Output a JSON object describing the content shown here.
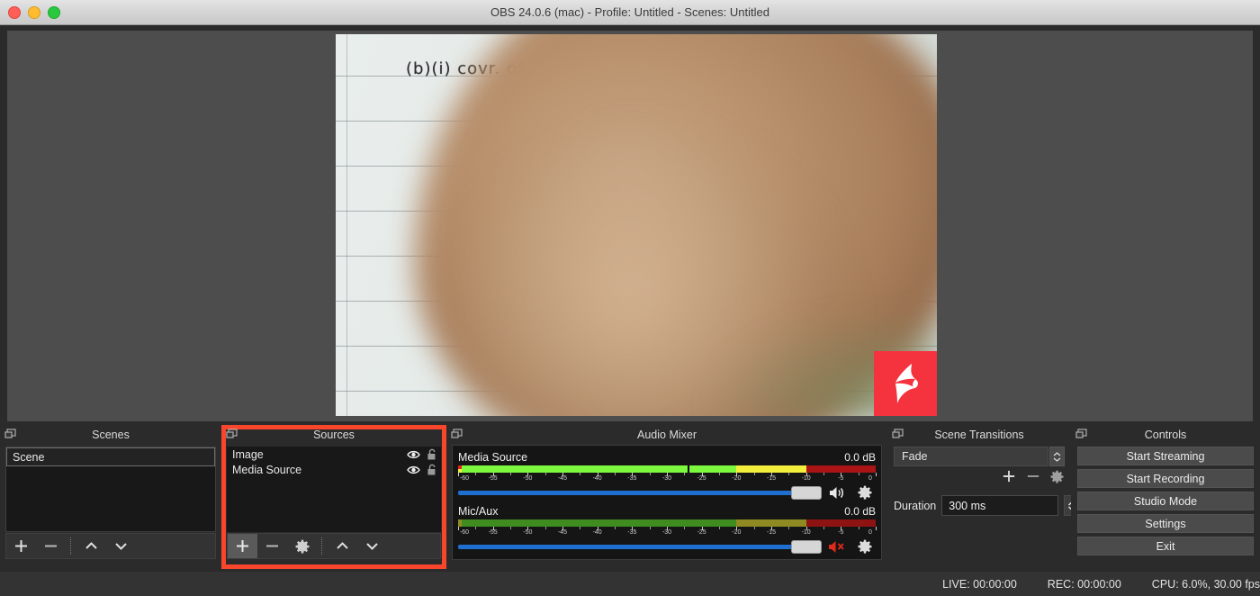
{
  "window": {
    "title": "OBS 24.0.6 (mac) - Profile: Untitled - Scenes: Untitled",
    "buttons": {
      "close": "close",
      "minimize": "minimize",
      "zoom": "zoom"
    }
  },
  "preview": {
    "handwriting": "(b)(i)   covr. of Q = (b,b",
    "watermark": "kinemaster-logo"
  },
  "scenes": {
    "title": "Scenes",
    "items": [
      {
        "label": "Scene",
        "selected": true
      }
    ],
    "toolbar": [
      {
        "name": "add-scene-button",
        "icon": "plus-icon"
      },
      {
        "name": "remove-scene-button",
        "icon": "minus-icon"
      },
      {
        "name": "move-scene-up-button",
        "icon": "chevron-up-icon"
      },
      {
        "name": "move-scene-down-button",
        "icon": "chevron-down-icon"
      }
    ]
  },
  "sources": {
    "title": "Sources",
    "highlighted": true,
    "highlight_color": "#f8452b",
    "items": [
      {
        "label": "Image",
        "visible": true,
        "locked": false
      },
      {
        "label": "Media Source",
        "visible": true,
        "locked": false
      }
    ],
    "toolbar": [
      {
        "name": "add-source-button",
        "icon": "plus-icon",
        "active": true
      },
      {
        "name": "remove-source-button",
        "icon": "minus-icon"
      },
      {
        "name": "source-properties-button",
        "icon": "gear-icon"
      },
      {
        "name": "move-source-up-button",
        "icon": "chevron-up-icon"
      },
      {
        "name": "move-source-down-button",
        "icon": "chevron-down-icon"
      }
    ]
  },
  "mixer": {
    "title": "Audio Mixer",
    "tick_labels": [
      "-60",
      "-55",
      "-50",
      "-45",
      "-40",
      "-35",
      "-30",
      "-25",
      "-20",
      "-15",
      "-10",
      "-5",
      "0"
    ],
    "channels": [
      {
        "name": "Media Source",
        "db": "0.0 dB",
        "level_pct": 100,
        "peak_pct": 55,
        "muted": false,
        "volume_pct": 100,
        "active": true
      },
      {
        "name": "Mic/Aux",
        "db": "0.0 dB",
        "level_pct": 100,
        "peak_pct": 0,
        "muted": true,
        "volume_pct": 100,
        "active": false
      }
    ]
  },
  "transitions": {
    "title": "Scene Transitions",
    "selected": "Fade",
    "duration_label": "Duration",
    "duration_value": "300 ms",
    "tools": [
      {
        "name": "add-transition-button",
        "icon": "plus-icon"
      },
      {
        "name": "remove-transition-button",
        "icon": "minus-icon"
      },
      {
        "name": "transition-properties-button",
        "icon": "gear-icon"
      }
    ]
  },
  "controls": {
    "title": "Controls",
    "buttons": [
      "Start Streaming",
      "Start Recording",
      "Studio Mode",
      "Settings",
      "Exit"
    ]
  },
  "status": {
    "live": "LIVE: 00:00:00",
    "rec": "REC: 00:00:00",
    "cpu": "CPU: 6.0%, 30.00 fps"
  }
}
